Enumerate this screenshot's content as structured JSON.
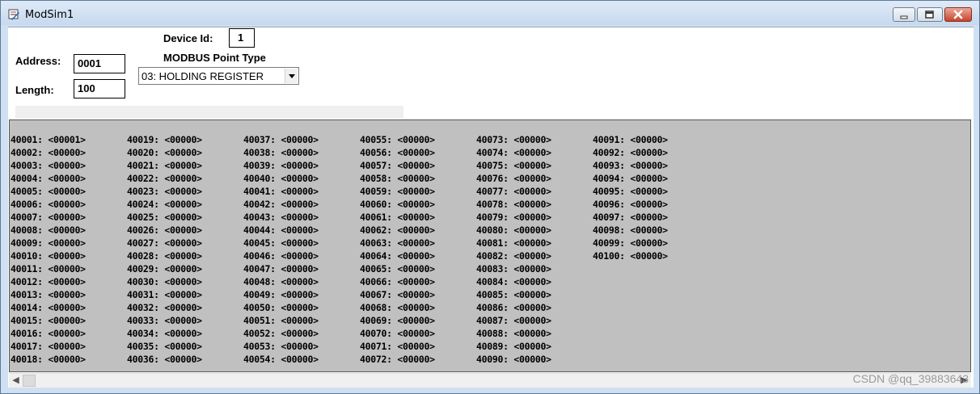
{
  "window": {
    "title": "ModSim1"
  },
  "form": {
    "device_id_label": "Device Id:",
    "device_id_value": "1",
    "address_label": "Address:",
    "address_value": "0001",
    "length_label": "Length:",
    "length_value": "100",
    "point_type_label": "MODBUS Point Type",
    "point_type_value": "03: HOLDING REGISTER"
  },
  "registers": [
    [
      "40001: <00001>",
      "40002: <00000>",
      "40003: <00000>",
      "40004: <00000>",
      "40005: <00000>",
      "40006: <00000>",
      "40007: <00000>",
      "40008: <00000>",
      "40009: <00000>",
      "40010: <00000>",
      "40011: <00000>",
      "40012: <00000>",
      "40013: <00000>",
      "40014: <00000>",
      "40015: <00000>",
      "40016: <00000>",
      "40017: <00000>",
      "40018: <00000>"
    ],
    [
      "40019: <00000>",
      "40020: <00000>",
      "40021: <00000>",
      "40022: <00000>",
      "40023: <00000>",
      "40024: <00000>",
      "40025: <00000>",
      "40026: <00000>",
      "40027: <00000>",
      "40028: <00000>",
      "40029: <00000>",
      "40030: <00000>",
      "40031: <00000>",
      "40032: <00000>",
      "40033: <00000>",
      "40034: <00000>",
      "40035: <00000>",
      "40036: <00000>"
    ],
    [
      "40037: <00000>",
      "40038: <00000>",
      "40039: <00000>",
      "40040: <00000>",
      "40041: <00000>",
      "40042: <00000>",
      "40043: <00000>",
      "40044: <00000>",
      "40045: <00000>",
      "40046: <00000>",
      "40047: <00000>",
      "40048: <00000>",
      "40049: <00000>",
      "40050: <00000>",
      "40051: <00000>",
      "40052: <00000>",
      "40053: <00000>",
      "40054: <00000>"
    ],
    [
      "40055: <00000>",
      "40056: <00000>",
      "40057: <00000>",
      "40058: <00000>",
      "40059: <00000>",
      "40060: <00000>",
      "40061: <00000>",
      "40062: <00000>",
      "40063: <00000>",
      "40064: <00000>",
      "40065: <00000>",
      "40066: <00000>",
      "40067: <00000>",
      "40068: <00000>",
      "40069: <00000>",
      "40070: <00000>",
      "40071: <00000>",
      "40072: <00000>"
    ],
    [
      "40073: <00000>",
      "40074: <00000>",
      "40075: <00000>",
      "40076: <00000>",
      "40077: <00000>",
      "40078: <00000>",
      "40079: <00000>",
      "40080: <00000>",
      "40081: <00000>",
      "40082: <00000>",
      "40083: <00000>",
      "40084: <00000>",
      "40085: <00000>",
      "40086: <00000>",
      "40087: <00000>",
      "40088: <00000>",
      "40089: <00000>",
      "40090: <00000>"
    ],
    [
      "40091: <00000>",
      "40092: <00000>",
      "40093: <00000>",
      "40094: <00000>",
      "40095: <00000>",
      "40096: <00000>",
      "40097: <00000>",
      "40098: <00000>",
      "40099: <00000>",
      "40100: <00000>"
    ]
  ],
  "watermark": "CSDN @qq_39883643",
  "icons": {
    "app": "modsim-app-icon",
    "minimize": "minimize-icon",
    "maximize": "maximize-icon",
    "close": "close-icon",
    "dropdown": "chevron-down-icon",
    "scroll_left": "scroll-left-icon",
    "scroll_right": "scroll-right-icon"
  }
}
